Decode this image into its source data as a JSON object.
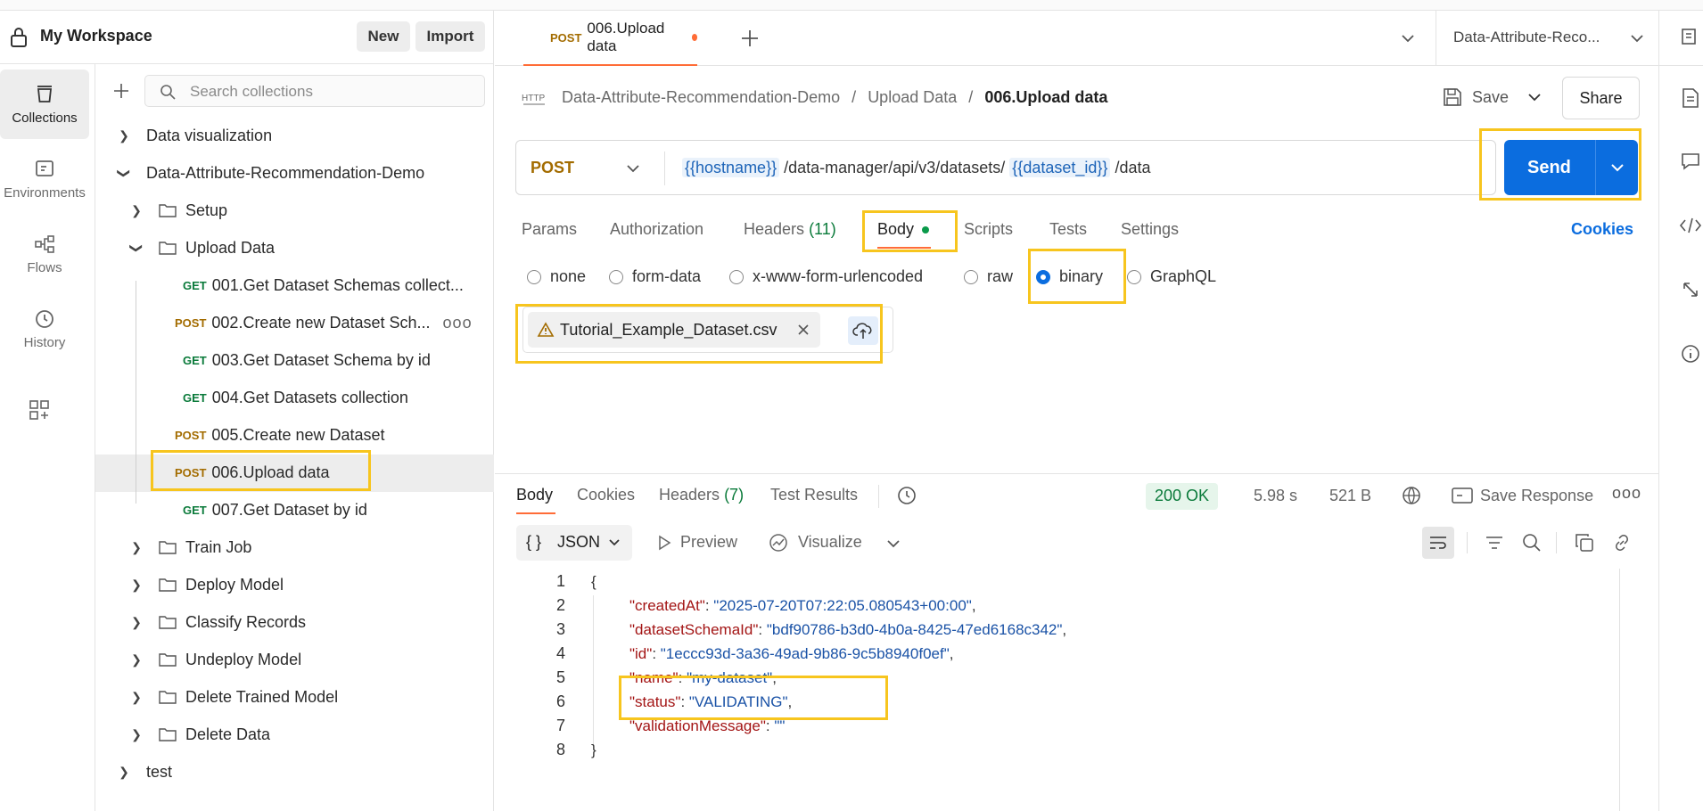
{
  "workspace": {
    "title": "My Workspace",
    "new_label": "New",
    "import_label": "Import"
  },
  "rail": [
    {
      "label": "Collections"
    },
    {
      "label": "Environments"
    },
    {
      "label": "Flows"
    },
    {
      "label": "History"
    }
  ],
  "search": {
    "placeholder": "Search collections"
  },
  "tree": {
    "data_visualization": "Data visualization",
    "root": "Data-Attribute-Recommendation-Demo",
    "setup": "Setup",
    "upload_data": "Upload Data",
    "req1": {
      "method": "GET",
      "name": "001.Get Dataset Schemas collect..."
    },
    "req2": {
      "method": "POST",
      "name": "002.Create new Dataset Sch..."
    },
    "req3": {
      "method": "GET",
      "name": "003.Get Dataset Schema by id"
    },
    "req4": {
      "method": "GET",
      "name": "004.Get Datasets collection"
    },
    "req5": {
      "method": "POST",
      "name": "005.Create new Dataset"
    },
    "req6": {
      "method": "POST",
      "name": "006.Upload data"
    },
    "req7": {
      "method": "GET",
      "name": "007.Get Dataset by id"
    },
    "train_job": "Train Job",
    "deploy_model": "Deploy Model",
    "classify_records": "Classify Records",
    "undeploy_model": "Undeploy Model",
    "delete_trained_model": "Delete Trained Model",
    "delete_data": "Delete Data",
    "test": "test"
  },
  "tab": {
    "method": "POST",
    "name": "006.Upload data"
  },
  "env": {
    "name": "Data-Attribute-Reco..."
  },
  "breadcrumb": {
    "part1": "Data-Attribute-Recommendation-Demo",
    "sep": "/",
    "part2": "Upload Data",
    "current": "006.Upload data"
  },
  "actions": {
    "save": "Save",
    "share": "Share",
    "send": "Send"
  },
  "request": {
    "method": "POST",
    "var_host": "{{hostname}}",
    "path1": "/data-manager/api/v3/datasets/",
    "var_id": "{{dataset_id}}",
    "path2": "/data"
  },
  "req_tabs": {
    "params": "Params",
    "authorization": "Authorization",
    "headers": "Headers",
    "headers_count": "(11)",
    "body": "Body",
    "scripts": "Scripts",
    "tests": "Tests",
    "settings": "Settings",
    "cookies": "Cookies"
  },
  "body_types": {
    "none": "none",
    "form_data": "form-data",
    "urlencoded": "x-www-form-urlencoded",
    "raw": "raw",
    "binary": "binary",
    "graphql": "GraphQL",
    "selected": "binary"
  },
  "file": {
    "name": "Tutorial_Example_Dataset.csv"
  },
  "response": {
    "tabs": {
      "body": "Body",
      "cookies": "Cookies",
      "headers": "Headers",
      "headers_count": "(7)",
      "test_results": "Test Results"
    },
    "status": "200 OK",
    "time": "5.98 s",
    "size": "521 B",
    "save_response": "Save Response",
    "format": "JSON",
    "preview": "Preview",
    "visualize": "Visualize",
    "lines": [
      {
        "n": "1",
        "text": "{"
      },
      {
        "n": "2",
        "key": "\"createdAt\"",
        "val": "\"2025-07-20T07:22:05.080543+00:00\""
      },
      {
        "n": "3",
        "key": "\"datasetSchemaId\"",
        "val": "\"bdf90786-b3d0-4b0a-8425-47ed6168c342\""
      },
      {
        "n": "4",
        "key": "\"id\"",
        "val": "\"1eccc93d-3a36-49ad-9b86-9c5b8940f0ef\""
      },
      {
        "n": "5",
        "key": "\"name\"",
        "val": "\"my-dataset\""
      },
      {
        "n": "6",
        "key": "\"status\"",
        "val": "\"VALIDATING\""
      },
      {
        "n": "7",
        "key": "\"validationMessage\"",
        "val": "\"\""
      },
      {
        "n": "8",
        "text": "}"
      }
    ]
  },
  "colors": {
    "accent_orange": "#ff6c37",
    "send_blue": "#0b6ddf",
    "highlight_yellow": "#f7c51e",
    "get_green": "#0a7a3a",
    "post_amber": "#a36c00"
  }
}
